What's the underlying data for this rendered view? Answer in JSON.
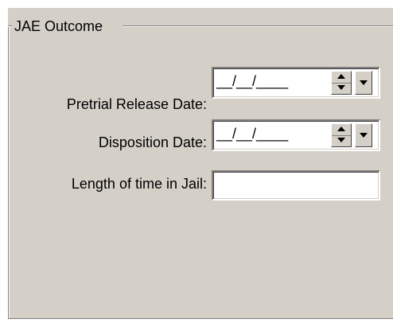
{
  "group": {
    "title": "JAE Outcome"
  },
  "fields": {
    "pretrial_release": {
      "label": "Pretrial Release Date:",
      "value": "__/__/____"
    },
    "disposition": {
      "label": "Disposition Date:",
      "value": "__/__/____"
    },
    "jail_length": {
      "label": "Length of time in Jail:",
      "value": ""
    }
  }
}
